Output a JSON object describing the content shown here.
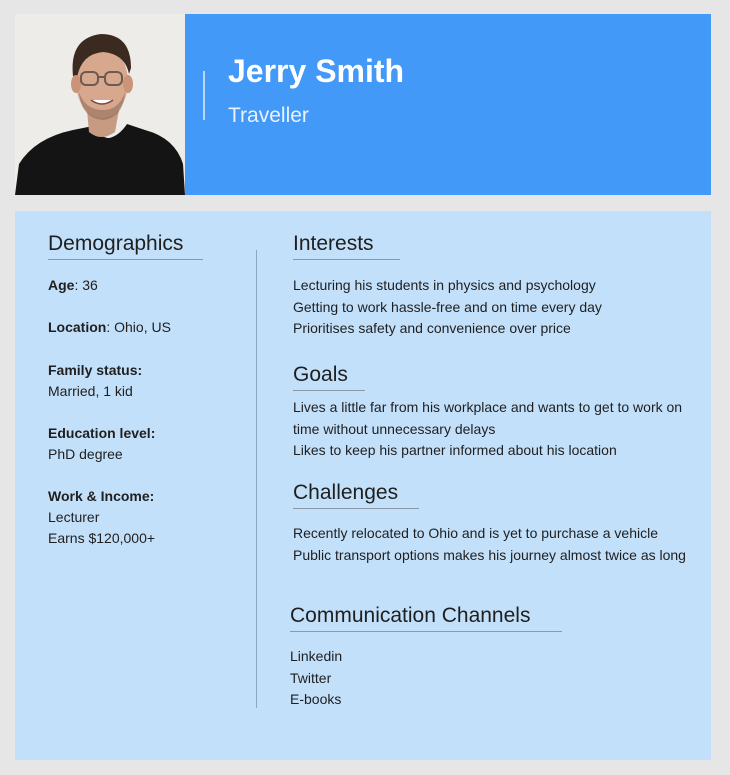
{
  "profile": {
    "name": "Jerry Smith",
    "role": "Traveller"
  },
  "demographics": {
    "title": "Demographics",
    "age_label": "Age",
    "age": "36",
    "location_label": "Location",
    "location": "Ohio, US",
    "family_label": "Family status:",
    "family": "Married, 1 kid",
    "education_label": "Education level:",
    "education": "PhD degree",
    "work_label": "Work & Income:",
    "work": "Lecturer",
    "income": "Earns $120,000+"
  },
  "interests": {
    "title": "Interests",
    "items": [
      "Lecturing his students in physics and psychology",
      "Getting to work hassle-free and on time every day",
      "Prioritises safety and convenience over price"
    ]
  },
  "goals": {
    "title": "Goals",
    "items": [
      "Lives a little far from his workplace and wants to get to work on time without unnecessary delays",
      "Likes to keep his partner informed about his location"
    ]
  },
  "challenges": {
    "title": "Challenges",
    "items": [
      "Recently relocated to Ohio and is yet to purchase a vehicle",
      "Public transport options makes his journey almost twice as long"
    ]
  },
  "channels": {
    "title": "Communication Channels",
    "items": [
      "Linkedin",
      "Twitter",
      "E-books"
    ]
  },
  "colors": {
    "header_bg": "#4299f7",
    "card_bg": "#c3e0fa",
    "page_bg": "#e6e6e6"
  }
}
